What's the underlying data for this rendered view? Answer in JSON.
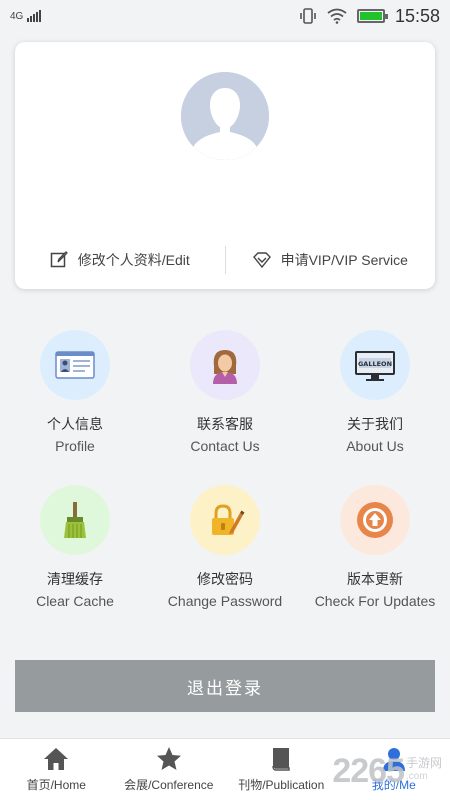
{
  "status_bar": {
    "network": "4G",
    "time": "15:58",
    "battery_level": 1.0,
    "battery_color": "#22c22c"
  },
  "profile_card": {
    "avatar_icon": "default-user-avatar",
    "edit_label": "修改个人资料/Edit",
    "edit_icon": "edit-icon",
    "vip_label": "申请VIP/VIP Service",
    "vip_icon": "diamond-icon"
  },
  "menu_grid": [
    {
      "cn": "个人信息",
      "en": "Profile",
      "icon": "id-card-icon",
      "bg": "#dceefe"
    },
    {
      "cn": "联系客服",
      "en": "Contact Us",
      "icon": "service-woman-icon",
      "bg": "#ece8fb"
    },
    {
      "cn": "关于我们",
      "en": "About Us",
      "icon": "gallon-monitor-icon",
      "bg": "#dceefe"
    },
    {
      "cn": "清理缓存",
      "en": "Clear Cache",
      "icon": "broom-icon",
      "bg": "#dff8dc"
    },
    {
      "cn": "修改密码",
      "en": "Change Password",
      "icon": "lock-pen-icon",
      "bg": "#fdf1c7"
    },
    {
      "cn": "版本更新",
      "en": "Check For Updates",
      "icon": "update-arrow-icon",
      "bg": "#fde8dd"
    }
  ],
  "logout_label": "退出登录",
  "logout_color": "#969c9d",
  "tabbar": [
    {
      "label": "首页/Home",
      "icon": "home-icon",
      "active": false
    },
    {
      "label": "会展/Conference",
      "icon": "star-icon",
      "active": false
    },
    {
      "label": "刊物/Publication",
      "icon": "book-icon",
      "active": false
    },
    {
      "label": "我的/Me",
      "icon": "user-icon",
      "active": true
    }
  ],
  "accent_color": "#2f6fdb",
  "watermark": {
    "number": "2265",
    "cn": "手游网",
    "en": ".com"
  }
}
